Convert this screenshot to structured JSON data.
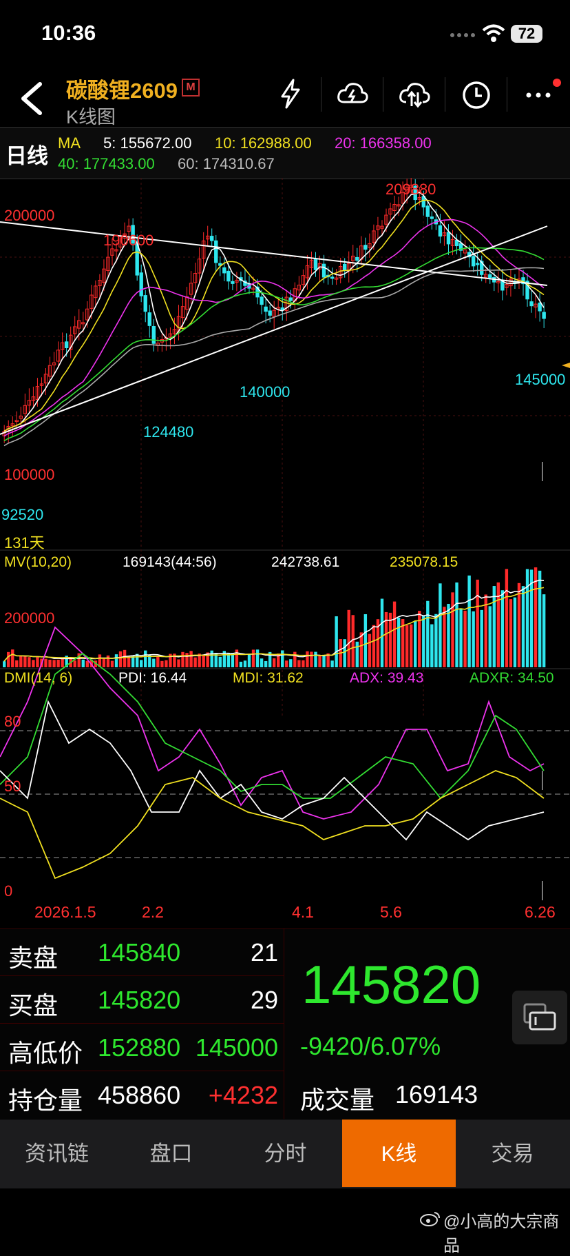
{
  "status": {
    "time": "10:36",
    "battery": "72"
  },
  "header": {
    "title": "碳酸锂2609",
    "badge": "M",
    "subtitle": "K线图"
  },
  "ma_bar": {
    "period": "日线",
    "label": "MA",
    "ma5": "5: 155672.00",
    "ma10": "10: 162988.00",
    "ma20": "20: 166358.00",
    "ma40": "40: 177433.00",
    "ma60": "60: 174310.67"
  },
  "kline": {
    "labels": {
      "high_peak": "209880",
      "level_200000": "200000",
      "peak1": "190600",
      "low_140000": "140000",
      "low_124480": "124480",
      "last_low": "145000",
      "level_100000": "100000",
      "start_low": "92520",
      "days": "131天"
    }
  },
  "volume": {
    "title": "MV(10,20)",
    "v1": "169143(44:56)",
    "v2": "242738.61",
    "v3": "235078.15",
    "level": "200000"
  },
  "dmi": {
    "title": "DMI(14, 6)",
    "pdi": "PDI: 16.44",
    "mdi": "MDI: 31.62",
    "adx": "ADX: 39.43",
    "adxr": "ADXR: 34.50",
    "levels": [
      "80",
      "50",
      "0"
    ]
  },
  "dates": [
    "2026.1.5",
    "2.2",
    "4.1",
    "5.6",
    "6.26"
  ],
  "quote": {
    "sell_label": "卖盘",
    "sell_price": "145840",
    "sell_qty": "21",
    "buy_label": "买盘",
    "buy_price": "145820",
    "buy_qty": "29",
    "hl_label": "高低价",
    "high": "152880",
    "low": "145000",
    "oi_label": "持仓量",
    "oi": "458860",
    "oi_change": "+4232",
    "last_price": "145820",
    "change": "-9420/6.07%",
    "vol_label": "成交量",
    "vol": "169143"
  },
  "tabs": [
    "资讯链",
    "盘口",
    "分时",
    "K线",
    "交易"
  ],
  "watermark": "@小高的大宗商品",
  "colors": {
    "up": "#ff2a2a",
    "down": "#2ee6ee",
    "accent": "#ee6a00",
    "price": "#2ee82e",
    "title": "#f0b020"
  }
}
